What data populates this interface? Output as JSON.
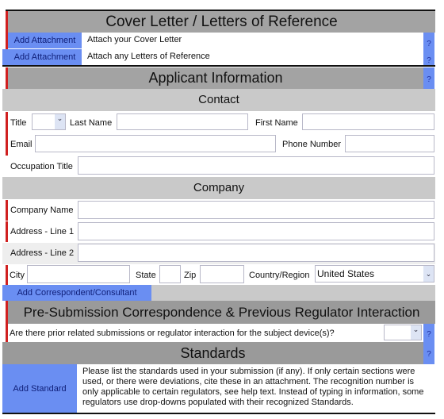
{
  "cover_letter": {
    "title": "Cover Letter / Letters of Reference",
    "rows": [
      {
        "button": "Add Attachment",
        "text": "Attach your Cover Letter",
        "help": "?"
      },
      {
        "button": "Add Attachment",
        "text": "Attach any Letters of Reference",
        "help": "?"
      }
    ]
  },
  "applicant": {
    "title": "Applicant Information",
    "help": "?",
    "contact": {
      "title": "Contact",
      "title_label": "Title",
      "title_value": "",
      "last_name_label": "Last Name",
      "last_name_value": "",
      "first_name_label": "First Name",
      "first_name_value": "",
      "email_label": "Email",
      "email_value": "",
      "phone_label": "Phone Number",
      "phone_value": "",
      "occupation_label": "Occupation Title",
      "occupation_value": ""
    },
    "company": {
      "title": "Company",
      "company_name_label": "Company Name",
      "company_name_value": "",
      "address1_label": "Address - Line 1",
      "address1_value": "",
      "address2_label": "Address - Line 2",
      "address2_value": "",
      "city_label": "City",
      "city_value": "",
      "state_label": "State",
      "state_value": "",
      "zip_label": "Zip",
      "zip_value": "",
      "country_label": "Country/Region",
      "country_value": "United States"
    },
    "add_correspondent": "Add Correspondent/Consultant"
  },
  "presubmission": {
    "title": "Pre-Submission Correspondence & Previous Regulator Interaction",
    "question": "Are there prior related submissions or regulator interaction for the subject device(s)?",
    "answer": "",
    "help": "?"
  },
  "standards": {
    "title": "Standards",
    "help": "?",
    "button": "Add Standard",
    "text": "Please list the standards used in your submission (if any). If only certain sections were used, or there were deviations, cite these in an attachment. The recognition number is only applicable to certain regulators, see help text. Instead of typing in information, some regulators use drop-downs populated with their recognized Standards."
  },
  "colors": {
    "accent_blue": "#6a8ef2",
    "required_red": "#d02020",
    "header_gray": "#a3a3a3"
  }
}
